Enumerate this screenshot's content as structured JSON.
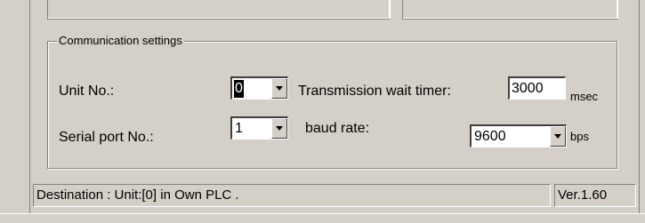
{
  "group": {
    "title": "Communication settings"
  },
  "unit_no": {
    "label": "Unit No.:",
    "value": "0"
  },
  "serial_port": {
    "label": "Serial port No.:",
    "value": "1"
  },
  "transmission_wait": {
    "label": "Transmission wait timer:",
    "value": "3000",
    "unit": "msec"
  },
  "baud_rate": {
    "label": "baud rate:",
    "value": "9600",
    "unit": "bps"
  },
  "status": {
    "destination": "Destination : Unit:[0]  in Own PLC .",
    "version": "Ver.1.60"
  }
}
